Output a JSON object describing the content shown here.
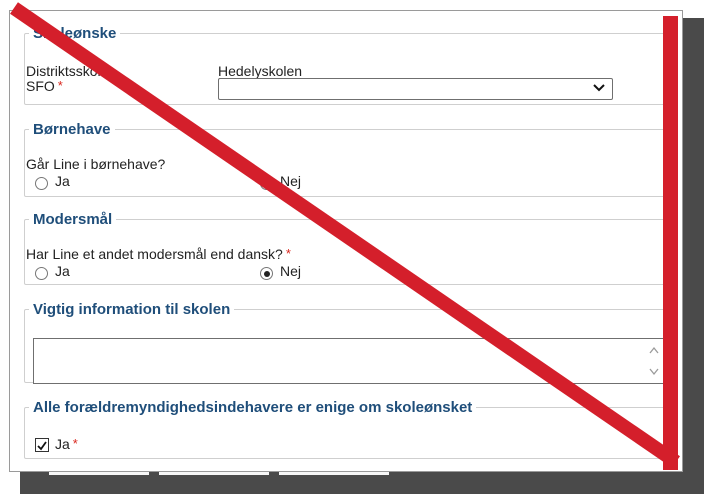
{
  "school_choice": {
    "legend": "Skoleønske",
    "district_label": "Distriktsskole",
    "district_value": "Hedelyskolen",
    "sfo_label": "SFO",
    "sfo_value": "",
    "required_mark": "*"
  },
  "kindergarten": {
    "legend": "Børnehave",
    "question": "Går Line i børnehave?",
    "options": [
      {
        "label": "Ja",
        "selected": false
      },
      {
        "label": "Nej",
        "selected": false
      }
    ]
  },
  "mother_tongue": {
    "legend": "Modersmål",
    "question": "Har Line et andet modersmål end dansk?",
    "required_mark": "*",
    "options": [
      {
        "label": "Ja",
        "selected": false
      },
      {
        "label": "Nej",
        "selected": true
      }
    ]
  },
  "important_info": {
    "legend": "Vigtig information til skolen",
    "value": ""
  },
  "agreement": {
    "legend": "Alle forældremyndighedsindehavere er enige om skoleønsket",
    "checkbox_label": "Ja",
    "checked": true,
    "required_mark": "*"
  },
  "colors": {
    "legend_blue": "#1f4e7a",
    "required_red": "#d9251c",
    "strike_red": "#d41f2b",
    "shadow": "#4a4a4a"
  },
  "icons": {
    "select_arrow": "chevron-down-icon",
    "scroll_up": "chevron-up-icon",
    "scroll_down": "chevron-down-icon",
    "checkbox_mark": "checkmark-icon"
  }
}
